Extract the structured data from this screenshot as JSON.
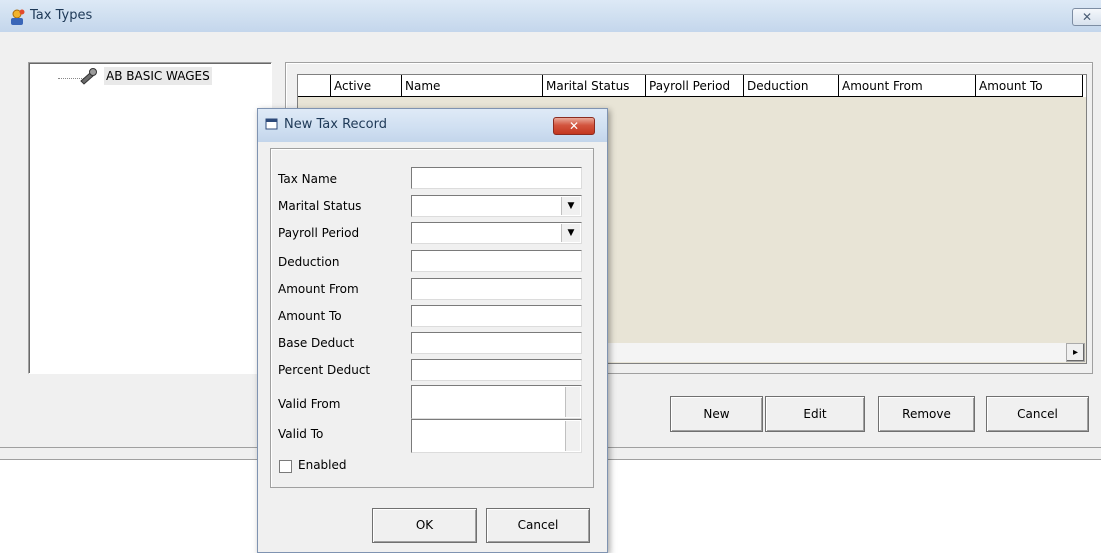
{
  "window": {
    "title": "Tax Types",
    "close_glyph": "✕"
  },
  "tree": {
    "nodes": [
      {
        "label": "AB BASIC WAGES",
        "icon": "wrench-tool-icon"
      }
    ]
  },
  "grid": {
    "columns": [
      "",
      "Active",
      "Name",
      "Marital Status",
      "Payroll Period",
      "Deduction",
      "Amount From",
      "Amount To"
    ],
    "scroll_right_glyph": "▸"
  },
  "buttons": {
    "new": "New",
    "edit": "Edit",
    "remove": "Remove",
    "cancel": "Cancel"
  },
  "dialog": {
    "title": "New Tax Record",
    "close_glyph": "✕",
    "fields": [
      {
        "label": "Tax Name",
        "value": ""
      },
      {
        "label": "Marital Status",
        "value": ""
      },
      {
        "label": "Payroll Period",
        "value": ""
      },
      {
        "label": "Deduction",
        "value": ""
      },
      {
        "label": "Amount From",
        "value": ""
      },
      {
        "label": "Amount To",
        "value": ""
      },
      {
        "label": "Base Deduct",
        "value": ""
      },
      {
        "label": "Percent Deduct",
        "value": ""
      },
      {
        "label": "Valid From",
        "value": ""
      },
      {
        "label": "Valid To",
        "value": ""
      }
    ],
    "enabled_label": "Enabled",
    "enabled_checked": false,
    "ok": "OK",
    "cancel": "Cancel",
    "dropdown_glyph": "▼"
  },
  "colors": {
    "titlebar": "#cfdff0",
    "grid_background": "#e8e4d6",
    "close_red": "#c3361f"
  }
}
